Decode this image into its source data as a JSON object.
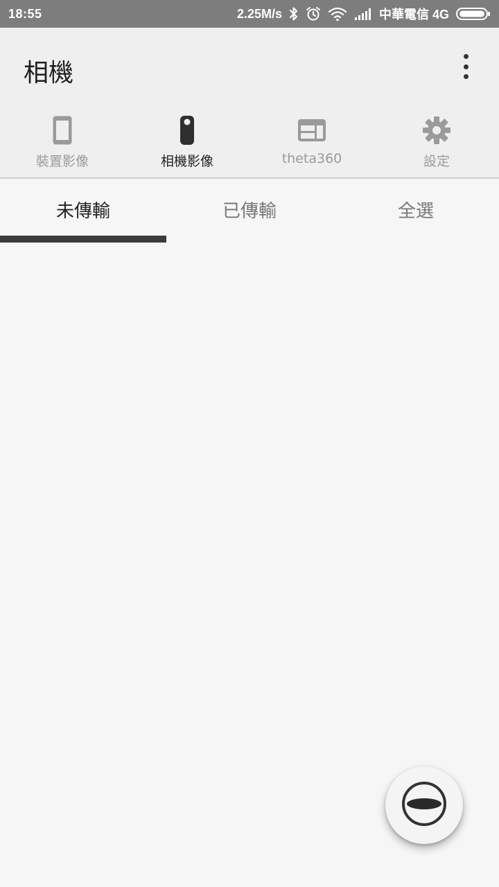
{
  "status_bar": {
    "time": "18:55",
    "speed": "2.25M/s",
    "carrier": "中華電信 4G",
    "icons": [
      "bluetooth-icon",
      "alarm-icon",
      "wifi-icon",
      "signal-icon",
      "battery-icon"
    ]
  },
  "app_bar": {
    "title": "相機",
    "menu_icon": "more-vert-icon"
  },
  "nav_tabs": [
    {
      "label": "裝置影像",
      "icon": "phone-icon",
      "active": false
    },
    {
      "label": "相機影像",
      "icon": "camera-icon",
      "active": true
    },
    {
      "label": "theta360",
      "icon": "gallery-icon",
      "active": false
    },
    {
      "label": "設定",
      "icon": "gear-icon",
      "active": false
    }
  ],
  "sub_tabs": [
    {
      "label": "未傳輸",
      "active": true
    },
    {
      "label": "已傳輸",
      "active": false
    },
    {
      "label": "全選",
      "active": false
    }
  ],
  "fab": {
    "icon": "theta-icon"
  },
  "colors": {
    "status_bar_bg": "#7d7d7d",
    "app_bar_bg": "#efefef",
    "content_bg": "#f6f6f6",
    "active_text": "#222222",
    "inactive_text": "#9a9a9a",
    "indicator": "#3c3c3c"
  }
}
